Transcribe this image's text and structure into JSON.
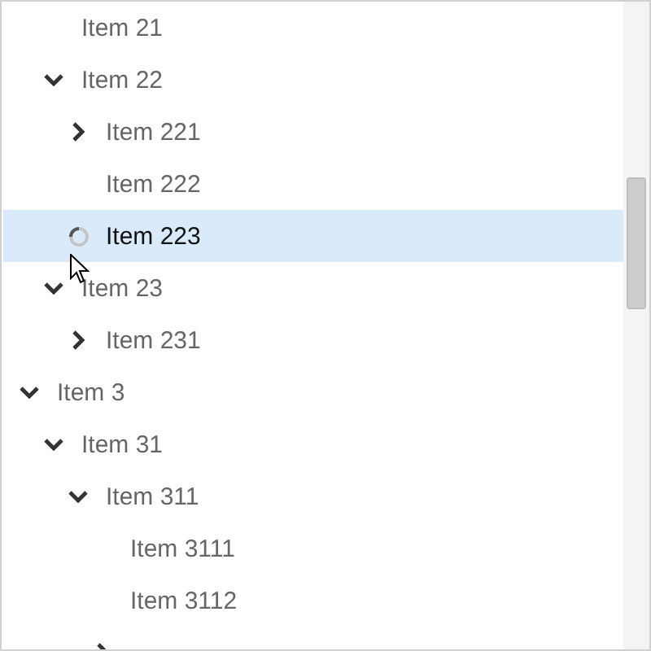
{
  "tree": [
    {
      "children": [
        {
          "label": "Item 21",
          "selected": false
        },
        {
          "label": "Item 22",
          "expanded": true,
          "selected": false,
          "children": [
            {
              "label": "Item 221",
              "expanded": false,
              "selected": false
            },
            {
              "label": "Item 222",
              "selected": false
            },
            {
              "label": "Item 223",
              "loading": true,
              "selected": true
            }
          ]
        },
        {
          "label": "Item 23",
          "expanded": true,
          "selected": false,
          "children": [
            {
              "label": "Item 231",
              "expanded": false,
              "selected": false
            }
          ]
        }
      ]
    },
    {
      "label": "Item 3",
      "expanded": true,
      "selected": false,
      "children": [
        {
          "label": "Item 31",
          "expanded": true,
          "selected": false,
          "children": [
            {
              "label": "Item 311",
              "expanded": true,
              "selected": false,
              "children": [
                {
                  "label": "Item 3111",
                  "selected": false
                },
                {
                  "label": "Item 3112",
                  "selected": false
                },
                {
                  "expanded": false
                }
              ]
            }
          ]
        }
      ]
    }
  ]
}
